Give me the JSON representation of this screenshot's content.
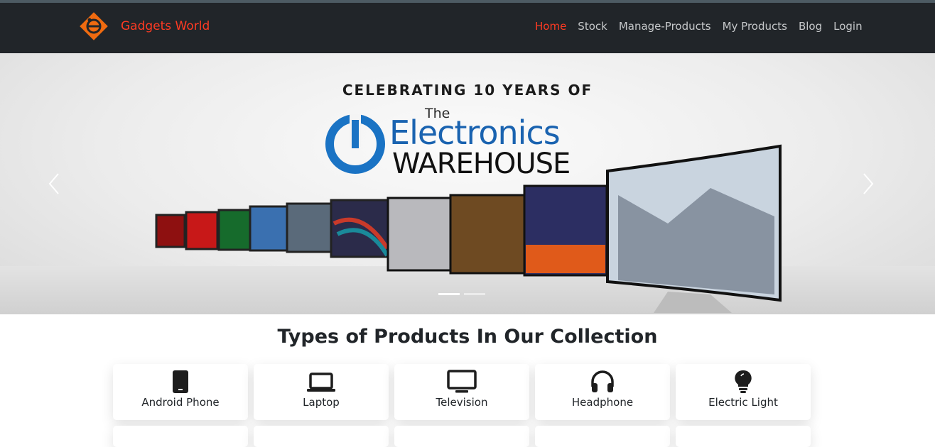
{
  "brand": {
    "name": "Gadgets World",
    "color": "#ff3b23",
    "logo_icon": "gadget-logo-icon"
  },
  "nav": {
    "items": [
      {
        "label": "Home",
        "active": true
      },
      {
        "label": "Stock"
      },
      {
        "label": "Manage-Products"
      },
      {
        "label": "My Products"
      },
      {
        "label": "Blog"
      },
      {
        "label": "Login"
      }
    ]
  },
  "hero": {
    "caption_top": "CELEBRATING 10 YEARS OF",
    "the": "The",
    "electronics": "Electronics",
    "warehouse": "WAREHOUSE",
    "prev_icon": "chevron-left-icon",
    "next_icon": "chevron-right-icon",
    "slides_count": 2,
    "active_slide": 1
  },
  "collection": {
    "title": "Types of Products In Our Collection",
    "items": [
      {
        "label": "Android Phone",
        "icon": "phone-icon"
      },
      {
        "label": "Laptop",
        "icon": "laptop-icon"
      },
      {
        "label": "Television",
        "icon": "tv-icon"
      },
      {
        "label": "Headphone",
        "icon": "headphone-icon"
      },
      {
        "label": "Electric Light",
        "icon": "lightbulb-icon"
      }
    ]
  },
  "colors": {
    "navbar": "#212529",
    "accent": "#ff3b23",
    "nav_text": "#c6c8ca",
    "electronics_blue": "#1a63b0"
  }
}
